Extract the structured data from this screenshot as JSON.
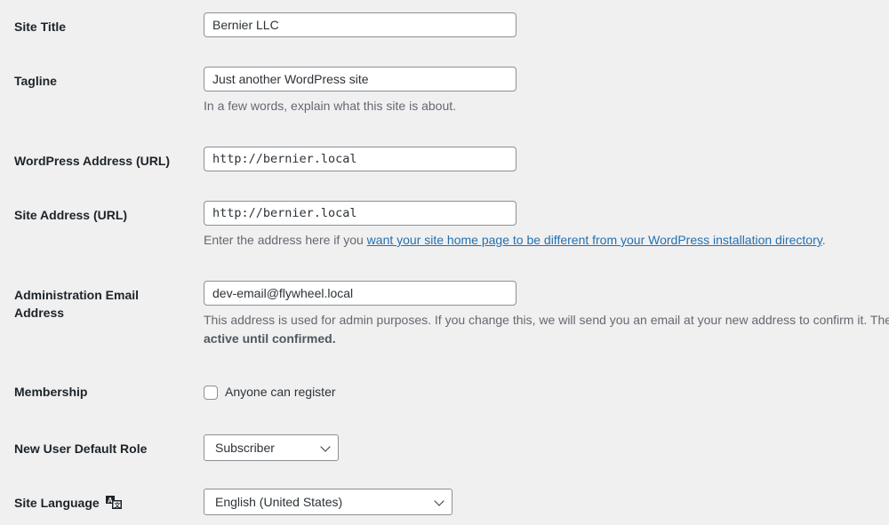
{
  "fields": {
    "site_title": {
      "label": "Site Title",
      "value": "Bernier LLC"
    },
    "tagline": {
      "label": "Tagline",
      "value": "Just another WordPress site",
      "description": "In a few words, explain what this site is about."
    },
    "wp_address": {
      "label": "WordPress Address (URL)",
      "value": "http://bernier.local"
    },
    "site_address": {
      "label": "Site Address (URL)",
      "value": "http://bernier.local",
      "description_prefix": "Enter the address here if you ",
      "description_link": "want your site home page to be different from your WordPress installation directory",
      "description_suffix": "."
    },
    "admin_email": {
      "label_line1": "Administration Email",
      "label_line2": "Address",
      "value": "dev-email@flywheel.local",
      "description_line1": "This address is used for admin purposes. If you change this, we will send you an email at your new address to confirm it. The new address will not become",
      "description_line2": "active until confirmed."
    },
    "membership": {
      "label": "Membership",
      "checkbox_label": "Anyone can register",
      "checked": false
    },
    "default_role": {
      "label": "New User Default Role",
      "selected": "Subscriber"
    },
    "site_language": {
      "label": "Site Language",
      "icon": "translation-icon",
      "selected": "English (United States)"
    }
  }
}
